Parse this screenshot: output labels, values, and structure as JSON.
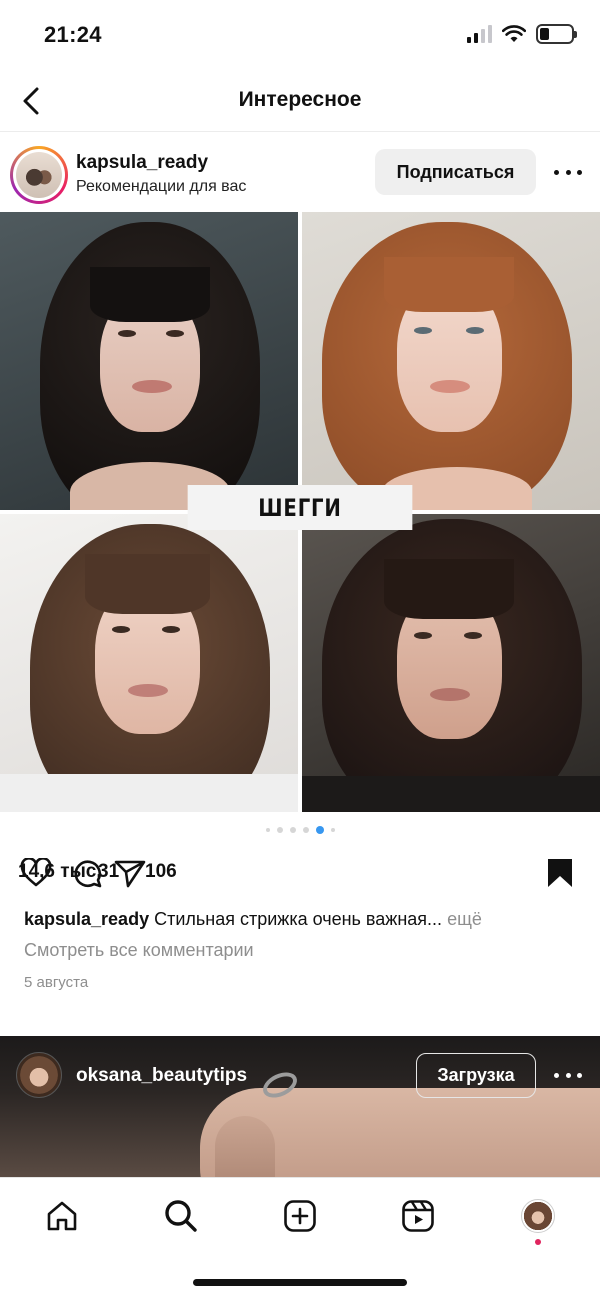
{
  "status_bar": {
    "time": "21:24",
    "battery_level": 0.3,
    "signal_bars": 2
  },
  "nav": {
    "title": "Интересное",
    "back_icon": "chevron-left-icon"
  },
  "post": {
    "username": "kapsula_ready",
    "subtitle": "Рекомендации для вас",
    "follow_label": "Подписаться",
    "more_icon": "more-horizontal-icon",
    "media_label": "ШЕГГИ",
    "carousel": {
      "total": 6,
      "active": 5
    },
    "likes": "14,6 тыс.",
    "comments": "31",
    "shares": "106",
    "caption_user": "kapsula_ready",
    "caption_text": "Стильная стрижка очень важная...",
    "caption_more": "ещё",
    "view_comments": "Смотреть все комментарии",
    "date": "5 августа"
  },
  "next_post": {
    "username": "oksana_beautytips",
    "button_label": "Загрузка"
  },
  "tab_bar": {
    "items": [
      "home-icon",
      "search-icon",
      "create-icon",
      "reels-icon",
      "profile-avatar"
    ],
    "notification_color": "#e0245e"
  },
  "colors": {
    "accent": "#3797f0",
    "secondary_text": "#8e8e8e"
  }
}
